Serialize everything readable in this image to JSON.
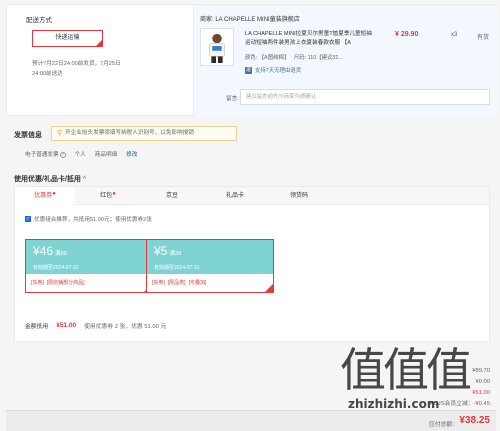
{
  "shipping": {
    "title": "配送方式",
    "method_label": "快递运输",
    "estimate_line1": "预计7月22日24:00前发货，7月25日",
    "estimate_line2": "24:00前送达"
  },
  "order_item": {
    "store_label": "商家:",
    "store_name": "LA CHAPELLE MINI童装旗舰店",
    "title": "LA CHAPELLE MINI拉夏贝尔男童T恤夏季儿童短袖运动短袖两件装男孩上衣夏装春款衣服 【A",
    "color_label": "颜色:",
    "color_value": "【A图纯棉】",
    "size_label": "尺码:",
    "size_value": "110【建议32...",
    "badge_icon": "退",
    "badge_text": "支持7天无理由退货",
    "price": "¥ 29.90",
    "qty": "x3",
    "stock": "有货",
    "remark_label": "留言:",
    "remark_placeholder": "建议留言前先与商家沟通确认"
  },
  "invoice": {
    "heading": "发票信息",
    "tip": "开企业抬头发票须填写纳税人识别号，以免影响报销",
    "type": "电子普通发票",
    "help_icon": "?",
    "title_type": "个人",
    "content": "商品明细",
    "edit": "修改"
  },
  "coupons": {
    "heading": "使用优惠/礼品卡/抵用",
    "toggle_icon": "^",
    "tabs": [
      {
        "label": "优惠券",
        "dot": "●"
      },
      {
        "label": "红包",
        "dot": "●"
      },
      {
        "label": "京豆",
        "dot": ""
      },
      {
        "label": "礼品卡",
        "dot": ""
      },
      {
        "label": "领货码",
        "dot": ""
      }
    ],
    "combo_text": "优惠组合推荐，共抵用51.00元；使用优惠券2张",
    "cards": [
      {
        "amount": "¥46",
        "condition": "满89",
        "valid": "有效期至2024-07-31",
        "tags": [
          "[东券]",
          "[限店铺部分商品]"
        ]
      },
      {
        "amount": "¥5",
        "condition": "满39",
        "valid": "有效期至2024-07-31",
        "tags": [
          "[东券]",
          "[限品类]",
          "[可叠加]"
        ]
      }
    ],
    "summary_label": "金额抵用",
    "summary_amount": "¥51.00",
    "summary_detail": "使用优惠券 2 张，优惠 51.00 元"
  },
  "totals": {
    "line1": "¥89.70",
    "line2": "¥0.00",
    "line3": "¥51.00",
    "plus_label": "PLUS会员立减：",
    "plus_value": "-¥0.45",
    "pay_label": "应付总额：",
    "pay_amount": "¥38.25"
  },
  "watermark": {
    "chars": "值值值",
    "url": "zhizhizhi.com"
  }
}
